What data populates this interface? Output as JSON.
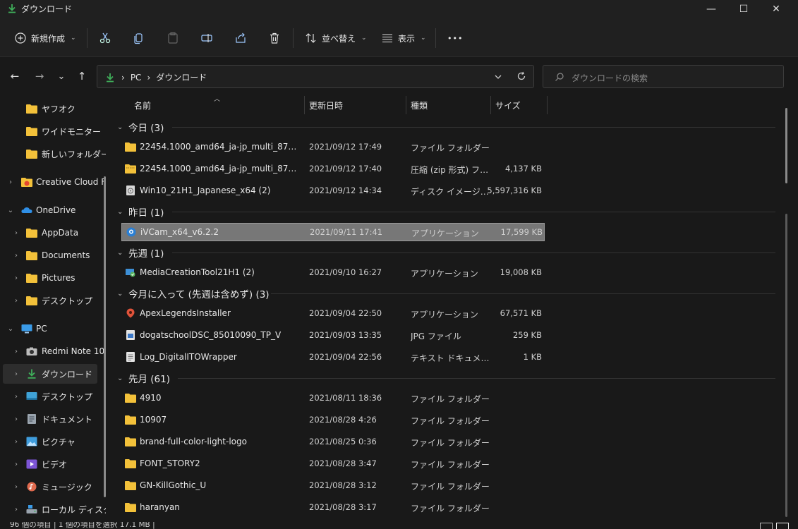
{
  "window": {
    "title": "ダウンロード",
    "minimize_glyph": "—",
    "maximize_glyph": "☐",
    "close_glyph": "✕"
  },
  "toolbar": {
    "new_label": "新規作成",
    "sort_label": "並べ替え",
    "view_label": "表示",
    "more_label": "•••"
  },
  "nav": {
    "back": "←",
    "forward": "→",
    "recent": "⌄",
    "up": "↑",
    "breadcrumb": [
      "PC",
      "ダウンロード"
    ],
    "separator": "›",
    "search_placeholder": "ダウンロードの検索"
  },
  "sidebar": {
    "items": [
      {
        "label": "ヤフオク",
        "icon": "folder-icon"
      },
      {
        "label": "ワイドモニター",
        "icon": "folder-icon"
      },
      {
        "label": "新しいフォルダー",
        "icon": "folder-icon"
      },
      {
        "label": "Creative Cloud Fi",
        "icon": "creative-cloud-icon"
      },
      {
        "label": "OneDrive",
        "icon": "onedrive-icon"
      },
      {
        "label": "AppData",
        "icon": "folder-icon"
      },
      {
        "label": "Documents",
        "icon": "folder-icon"
      },
      {
        "label": "Pictures",
        "icon": "folder-icon"
      },
      {
        "label": "デスクトップ",
        "icon": "folder-icon"
      },
      {
        "label": "PC",
        "icon": "pc-icon"
      },
      {
        "label": "Redmi Note 10",
        "icon": "camera-icon"
      },
      {
        "label": "ダウンロード",
        "icon": "download-icon"
      },
      {
        "label": "デスクトップ",
        "icon": "desktop-icon"
      },
      {
        "label": "ドキュメント",
        "icon": "document-icon"
      },
      {
        "label": "ピクチャ",
        "icon": "pictures-icon"
      },
      {
        "label": "ビデオ",
        "icon": "video-icon"
      },
      {
        "label": "ミュージック",
        "icon": "music-icon"
      },
      {
        "label": "ローカル ディスク (",
        "icon": "disk-icon"
      }
    ]
  },
  "columns": {
    "name": "名前",
    "date": "更新日時",
    "type": "種類",
    "size": "サイズ"
  },
  "groups": [
    {
      "label": "今日 (3)"
    },
    {
      "label": "昨日 (1)"
    },
    {
      "label": "先週 (1)"
    },
    {
      "label": "今月に入って (先週は含めず) (3)"
    },
    {
      "label": "先月 (61)"
    }
  ],
  "files": [
    {
      "name": "22454.1000_amd64_ja-jp_multi_879e6f01_...",
      "date": "2021/09/12 17:49",
      "type": "ファイル フォルダー",
      "size": "",
      "icon": "folder-icon"
    },
    {
      "name": "22454.1000_amd64_ja-jp_multi_879e6f01_...",
      "date": "2021/09/12 17:40",
      "type": "圧縮 (zip 形式) フォ...",
      "size": "4,137 KB",
      "icon": "zip-folder-icon"
    },
    {
      "name": "Win10_21H1_Japanese_x64 (2)",
      "date": "2021/09/12 14:34",
      "type": "ディスク イメージ ファ...",
      "size": "5,597,316 KB",
      "icon": "disk-image-icon"
    },
    {
      "name": "iVCam_x64_v6.2.2",
      "date": "2021/09/11 17:41",
      "type": "アプリケーション",
      "size": "17,599 KB",
      "icon": "ivcam-icon"
    },
    {
      "name": "MediaCreationTool21H1 (2)",
      "date": "2021/09/10 16:27",
      "type": "アプリケーション",
      "size": "19,008 KB",
      "icon": "media-creation-icon"
    },
    {
      "name": "ApexLegendsInstaller",
      "date": "2021/09/04 22:50",
      "type": "アプリケーション",
      "size": "67,571 KB",
      "icon": "apex-icon"
    },
    {
      "name": "dogatschoolDSC_85010090_TP_V",
      "date": "2021/09/03 13:35",
      "type": "JPG ファイル",
      "size": "259 KB",
      "icon": "image-file-icon"
    },
    {
      "name": "Log_DigitalITOWrapper",
      "date": "2021/09/04 22:56",
      "type": "テキスト ドキュメント",
      "size": "1 KB",
      "icon": "text-file-icon"
    },
    {
      "name": "4910",
      "date": "2021/08/11 18:36",
      "type": "ファイル フォルダー",
      "size": "",
      "icon": "folder-icon"
    },
    {
      "name": "10907",
      "date": "2021/08/28 4:26",
      "type": "ファイル フォルダー",
      "size": "",
      "icon": "folder-icon"
    },
    {
      "name": "brand-full-color-light-logo",
      "date": "2021/08/25 0:36",
      "type": "ファイル フォルダー",
      "size": "",
      "icon": "folder-icon"
    },
    {
      "name": "FONT_STORY2",
      "date": "2021/08/28 3:47",
      "type": "ファイル フォルダー",
      "size": "",
      "icon": "folder-icon"
    },
    {
      "name": "GN-KillGothic_U",
      "date": "2021/08/28 3:12",
      "type": "ファイル フォルダー",
      "size": "",
      "icon": "folder-icon"
    },
    {
      "name": "haranyan",
      "date": "2021/08/28 3:17",
      "type": "ファイル フォルダー",
      "size": "",
      "icon": "folder-icon"
    }
  ],
  "status": {
    "text": "96 個の項目 | 1 個の項目を選択 17.1 MB |"
  },
  "colors": {
    "background": "#191919",
    "chrome": "#202020",
    "selected_row": "#777777",
    "folder": "#f3c13a",
    "download_green": "#3fae5a"
  }
}
